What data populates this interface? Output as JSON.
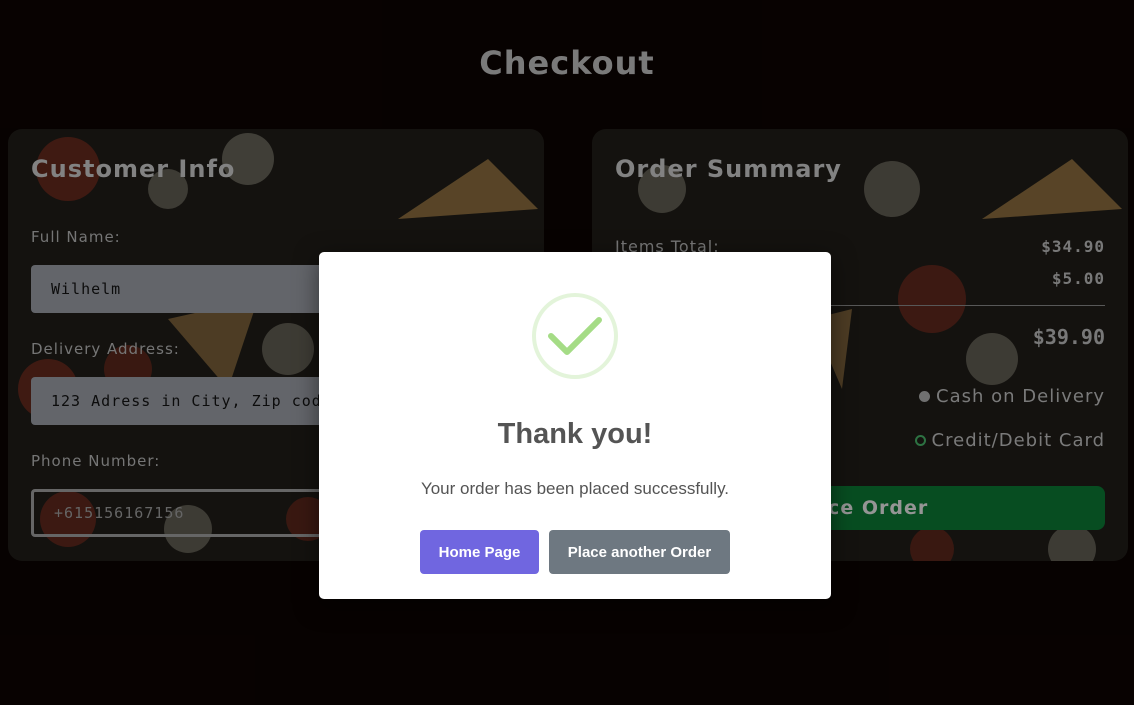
{
  "page": {
    "title": "Checkout"
  },
  "customer": {
    "title": "Customer Info",
    "full_name_label": "Full Name:",
    "full_name_value": "Wilhelm",
    "address_label": "Delivery Address:",
    "address_value": "123 Adress in City, Zip code",
    "phone_label": "Phone Number:",
    "phone_value": "+615156167156"
  },
  "summary": {
    "title": "Order Summary",
    "items_total_label": "Items Total:",
    "items_total_value": "$34.90",
    "delivery_value": "$5.00",
    "grand_total": "$39.90",
    "payment_options": [
      "Cash on Delivery",
      "Credit/Debit Card"
    ],
    "place_order_label": "Place Order"
  },
  "modal": {
    "title": "Thank you!",
    "message": "Your order has been placed successfully.",
    "home_button": "Home Page",
    "another_button": "Place another Order"
  },
  "colors": {
    "accent": "#7066e0",
    "success": "#a5dc86",
    "place_order": "#0a6b2e"
  }
}
